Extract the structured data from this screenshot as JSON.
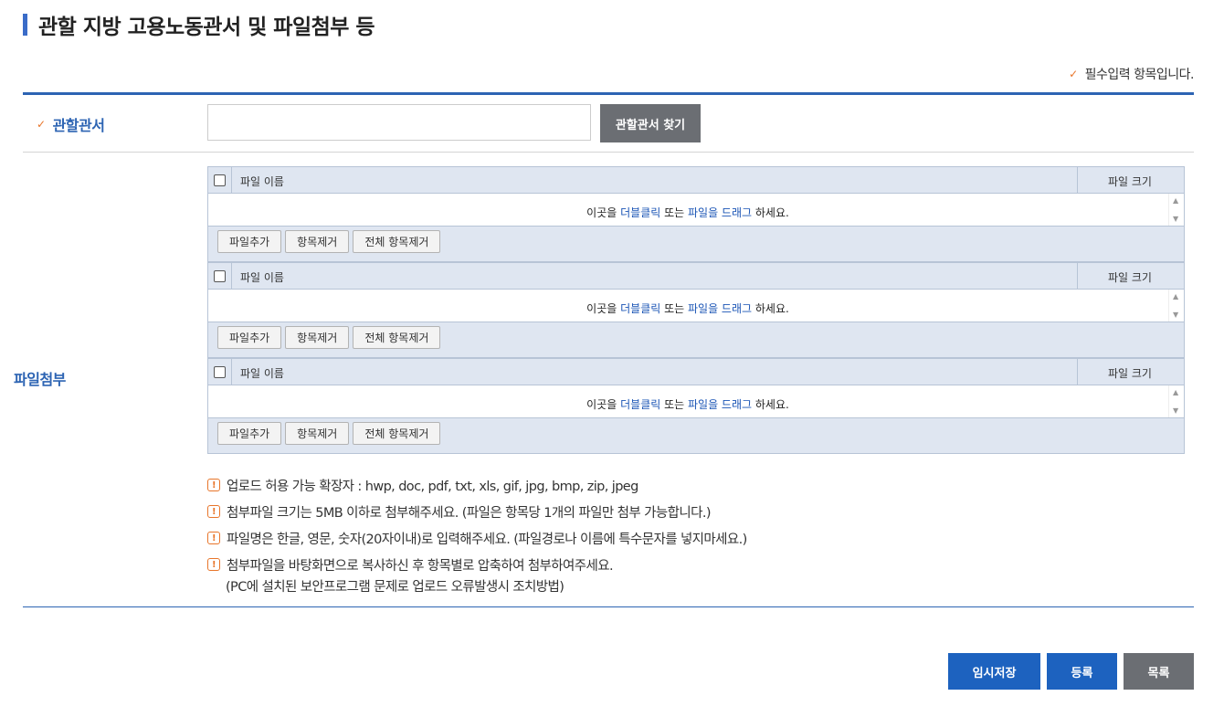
{
  "page": {
    "title": "관할 지방 고용노동관서 및 파일첨부 등"
  },
  "required_note": "필수입력 항목입니다.",
  "office": {
    "label": "관할관서",
    "input_value": "",
    "find_button": "관할관서 찾기"
  },
  "files": {
    "label": "파일첨부",
    "uploaders": [
      {
        "col_name": "파일 이름",
        "col_size": "파일 크기",
        "drop_pre": "이곳을 ",
        "drop_link1": "더블클릭",
        "drop_mid": " 또는 ",
        "drop_link2": "파일을 드래그",
        "drop_post": " 하세요.",
        "btn_add": "파일추가",
        "btn_remove": "항목제거",
        "btn_remove_all": "전체 항목제거"
      },
      {
        "col_name": "파일 이름",
        "col_size": "파일 크기",
        "drop_pre": "이곳을 ",
        "drop_link1": "더블클릭",
        "drop_mid": " 또는 ",
        "drop_link2": "파일을 드래그",
        "drop_post": " 하세요.",
        "btn_add": "파일추가",
        "btn_remove": "항목제거",
        "btn_remove_all": "전체 항목제거"
      },
      {
        "col_name": "파일 이름",
        "col_size": "파일 크기",
        "drop_pre": "이곳을 ",
        "drop_link1": "더블클릭",
        "drop_mid": " 또는 ",
        "drop_link2": "파일을 드래그",
        "drop_post": " 하세요.",
        "btn_add": "파일추가",
        "btn_remove": "항목제거",
        "btn_remove_all": "전체 항목제거"
      }
    ],
    "notes": [
      "업로드 허용 가능 확장자 : hwp, doc, pdf, txt, xls, gif, jpg, bmp, zip, jpeg",
      "첨부파일 크기는 5MB 이하로 첨부해주세요. (파일은 항목당 1개의 파일만 첨부 가능합니다.)",
      "파일명은 한글, 영문, 숫자(20자이내)로 입력해주세요. (파일경로나 이름에 특수문자를 넣지마세요.)",
      "첨부파일을 바탕화면으로 복사하신 후 항목별로 압축하여 첨부하여주세요."
    ],
    "note_sub": "(PC에 설치된 보안프로그램 문제로 업로드 오류발생시 조치방법)"
  },
  "actions": {
    "temp_save": "임시저장",
    "register": "등록",
    "list": "목록"
  },
  "colors": {
    "accent": "#2d64b3",
    "check": "#e8752a",
    "button_gray": "#6b6e73"
  }
}
